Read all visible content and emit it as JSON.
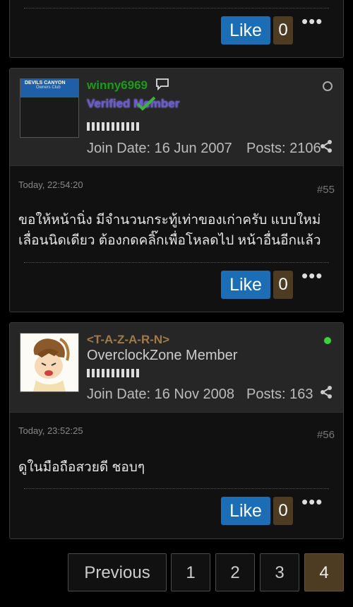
{
  "top_post": {
    "like_label": "Like",
    "like_count": "0"
  },
  "posts": [
    {
      "username": "winny6969",
      "username_color": "#1a9c1a",
      "avatar_text": "DEVILS CANYON",
      "avatar_subtext": "Owners Club",
      "user_title": "Verified Member",
      "join_label": "Join Date: 16 Jun 2007",
      "posts_label": "Posts: 2106",
      "status": "offline",
      "date": "Today, 22:54:20",
      "number": "#55",
      "message_line1": "ขอให้หน้านิ่ง มีจำนวนกระทู้เท่าของเก่าครับ แบบใหม่",
      "message_line2": "เลื่อนนิดเดียว ต้องกดคลิ๊กเพื่อโหลดไป หน้าอื่นอีกแล้ว",
      "like_label": "Like",
      "like_count": "0"
    },
    {
      "username": "<T-A-Z-A-R-N>",
      "username_color": "#a07a4a",
      "user_title": "OverclockZone Member",
      "join_label": "Join Date: 16 Nov 2008",
      "posts_label": "Posts: 163",
      "status": "online",
      "date": "Today, 23:52:25",
      "number": "#56",
      "message_line1": "ดูในมือถือสวยดี ชอบๆ",
      "like_label": "Like",
      "like_count": "0"
    }
  ],
  "pagination": {
    "previous_label": "Previous",
    "pages": [
      "1",
      "2",
      "3",
      "4"
    ],
    "current_page": "4"
  },
  "icons": [
    "speech-bubble-icon",
    "share-icon",
    "more-options-icon",
    "status-dot-icon",
    "checkmark-icon"
  ]
}
